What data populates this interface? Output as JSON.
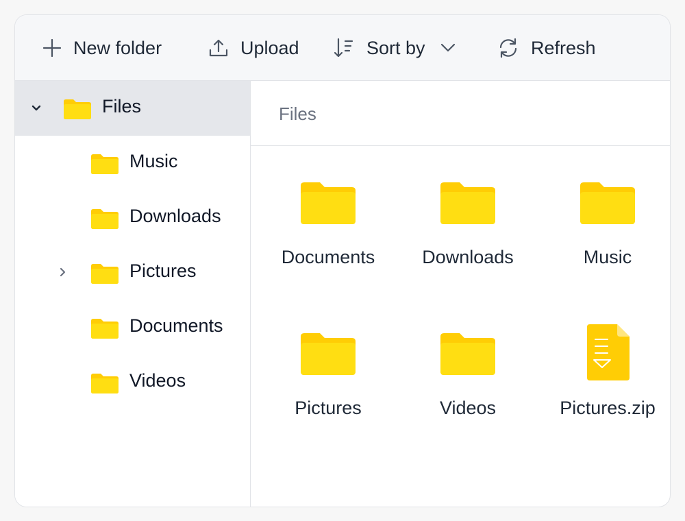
{
  "colors": {
    "folder_back": "#FFCD05",
    "folder_front": "#FFDE12",
    "selected_bg": "#E5E7EB",
    "toolbar_bg": "#F6F7F9",
    "border": "#E1E3E7",
    "muted_text": "#6B7280"
  },
  "toolbar": {
    "new_folder": {
      "label": "New folder",
      "icon": "plus-icon"
    },
    "upload": {
      "label": "Upload",
      "icon": "upload-icon"
    },
    "sort_by": {
      "label": "Sort by",
      "icon": "sort-icon",
      "caret": "chevron-down-icon"
    },
    "refresh": {
      "label": "Refresh",
      "icon": "refresh-icon"
    }
  },
  "sidebar": {
    "root": {
      "label": "Files",
      "expanded": true,
      "selected": true
    },
    "items": [
      {
        "label": "Music",
        "has_children": false
      },
      {
        "label": "Downloads",
        "has_children": false
      },
      {
        "label": "Pictures",
        "has_children": true
      },
      {
        "label": "Documents",
        "has_children": false
      },
      {
        "label": "Videos",
        "has_children": false
      }
    ]
  },
  "breadcrumb": {
    "path": "Files"
  },
  "files": [
    {
      "name": "Documents",
      "type": "folder"
    },
    {
      "name": "Downloads",
      "type": "folder"
    },
    {
      "name": "Music",
      "type": "folder"
    },
    {
      "name": "Pictures",
      "type": "folder"
    },
    {
      "name": "Videos",
      "type": "folder"
    },
    {
      "name": "Pictures.zip",
      "type": "zip"
    }
  ]
}
